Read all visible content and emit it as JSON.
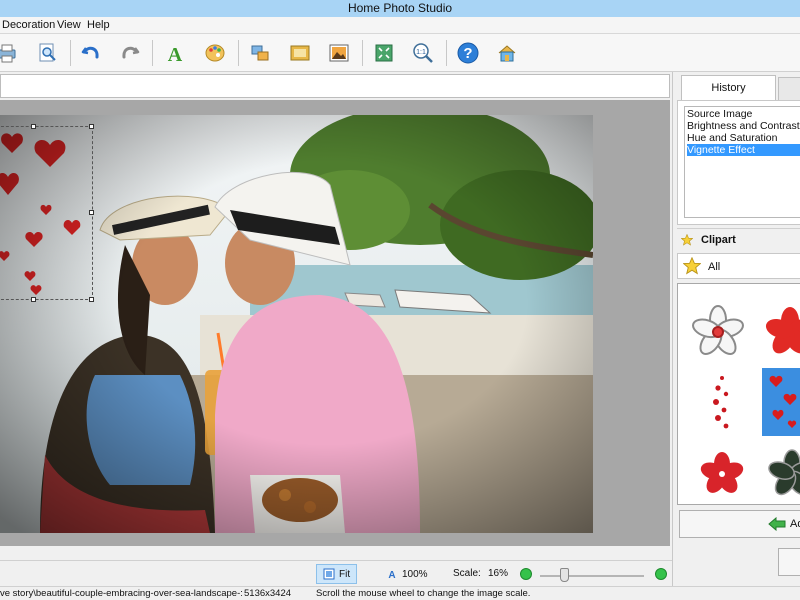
{
  "window": {
    "title": "Home Photo Studio"
  },
  "menu": {
    "items": [
      "Decoration",
      "View",
      "Help"
    ]
  },
  "path_field": {
    "value": ""
  },
  "history": {
    "tab_label": "History",
    "items": [
      "Source Image",
      "Brightness and Contrast",
      "Hue and Saturation",
      "Vignette Effect"
    ],
    "selected_index": 3
  },
  "clipart": {
    "header": "Clipart",
    "category": "All",
    "items": [
      "flower-white-icon",
      "flower-red-icon",
      "hearts-trail-icon",
      "hearts-scatter-icon",
      "flower-red-small-icon",
      "flower-dark-icon"
    ],
    "selected_index": 3,
    "add_label": "Ad"
  },
  "zoom": {
    "fit_label": "Fit",
    "actual_label": "100%",
    "scale_label": "Scale:",
    "scale_value": "16%",
    "slider_level": 0.16
  },
  "status": {
    "file_text": "ve story\\beautiful-couple-embracing-over-sea-landscape-:",
    "dimensions": "5136x3424",
    "hint": "Scroll the mouse wheel to change the image scale."
  },
  "colors": {
    "titlebar": "#a8d4f5",
    "selection": "#3399ff",
    "accent_green": "#35c24a"
  }
}
